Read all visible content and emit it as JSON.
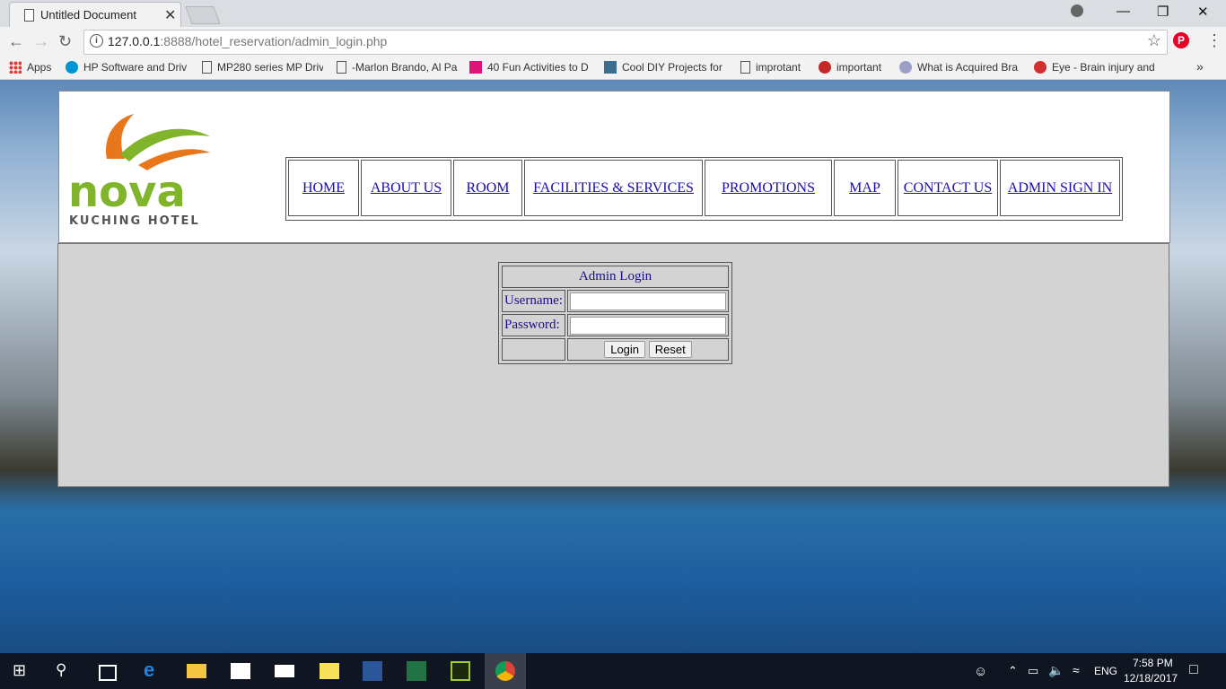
{
  "browser": {
    "tab_title": "Untitled Document",
    "tab_close": "✕",
    "url_host": "127.0.0.1",
    "url_rest": ":8888/hotel_reservation/admin_login.php",
    "bookmarks": [
      {
        "label": "Apps"
      },
      {
        "label": "HP Software and Driv"
      },
      {
        "label": "MP280 series MP Driv"
      },
      {
        "label": "-Marlon Brando, Al Pa"
      },
      {
        "label": "40 Fun Activities to D"
      },
      {
        "label": "Cool DIY Projects for"
      },
      {
        "label": "improtant"
      },
      {
        "label": "important"
      },
      {
        "label": "What is Acquired Bra"
      },
      {
        "label": "Eye - Brain injury and"
      }
    ]
  },
  "header": {
    "logo_text": "nova",
    "logo_sub": "KUCHING HOTEL",
    "nav": [
      {
        "label": "HOME"
      },
      {
        "label": "ABOUT US"
      },
      {
        "label": "ROOM"
      },
      {
        "label": "FACILITIES & SERVICES"
      },
      {
        "label": "PROMOTIONS"
      },
      {
        "label": "MAP"
      },
      {
        "label": "CONTACT US"
      },
      {
        "label": "ADMIN SIGN IN"
      }
    ]
  },
  "login": {
    "title": "Admin Login",
    "username_label": "Username:",
    "password_label": "Password:",
    "username_value": "",
    "password_value": "",
    "login_button": "Login",
    "reset_button": "Reset"
  },
  "taskbar": {
    "lang": "ENG",
    "time": "7:58 PM",
    "date": "12/18/2017"
  }
}
